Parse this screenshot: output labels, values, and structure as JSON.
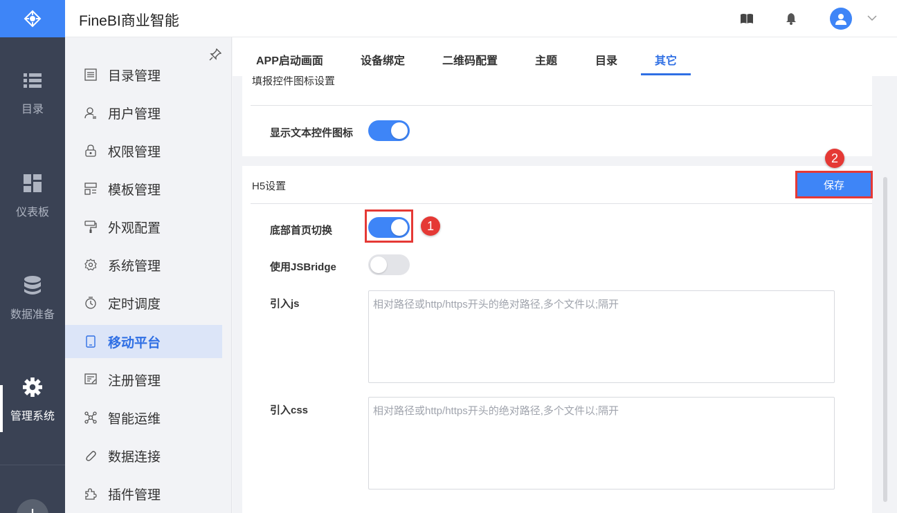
{
  "app": {
    "title": "FineBI商业智能"
  },
  "rail": {
    "items": [
      {
        "label": "目录",
        "icon": "list-icon"
      },
      {
        "label": "仪表板",
        "icon": "dashboard-icon"
      },
      {
        "label": "数据准备",
        "icon": "database-icon"
      },
      {
        "label": "管理系统",
        "icon": "gear-icon",
        "active": true
      }
    ],
    "plus": "+"
  },
  "sidebar": {
    "items": [
      {
        "label": "目录管理",
        "icon": "catalog-icon"
      },
      {
        "label": "用户管理",
        "icon": "user-icon"
      },
      {
        "label": "权限管理",
        "icon": "lock-icon"
      },
      {
        "label": "模板管理",
        "icon": "template-icon"
      },
      {
        "label": "外观配置",
        "icon": "brush-icon"
      },
      {
        "label": "系统管理",
        "icon": "settings-icon"
      },
      {
        "label": "定时调度",
        "icon": "timer-icon"
      },
      {
        "label": "移动平台",
        "icon": "mobile-icon",
        "active": true
      },
      {
        "label": "注册管理",
        "icon": "register-icon"
      },
      {
        "label": "智能运维",
        "icon": "ops-icon"
      },
      {
        "label": "数据连接",
        "icon": "link-icon"
      },
      {
        "label": "插件管理",
        "icon": "plugin-icon"
      }
    ]
  },
  "tabs": [
    {
      "label": "APP启动画面"
    },
    {
      "label": "设备绑定"
    },
    {
      "label": "二维码配置"
    },
    {
      "label": "主题"
    },
    {
      "label": "目录"
    },
    {
      "label": "其它",
      "active": true
    }
  ],
  "section1": {
    "title": "填报控件图标设置",
    "fields": {
      "show_text_icon": {
        "label": "显示文本控件图标",
        "value": true
      }
    }
  },
  "section2": {
    "title": "H5设置",
    "save_label": "保存",
    "fields": {
      "bottom_home_switch": {
        "label": "底部首页切换",
        "value": true
      },
      "jsbridge": {
        "label": "使用JSBridge",
        "value": false
      },
      "import_js": {
        "label": "引入js",
        "placeholder": "相对路径或http/https开头的绝对路径,多个文件以;隔开"
      },
      "import_css": {
        "label": "引入css",
        "placeholder": "相对路径或http/https开头的绝对路径,多个文件以;隔开"
      }
    }
  },
  "annotations": {
    "badge1": "1",
    "badge2": "2"
  },
  "colors": {
    "accent": "#3e85f7",
    "rail_bg": "#3a4254",
    "highlight": "#e53935"
  }
}
